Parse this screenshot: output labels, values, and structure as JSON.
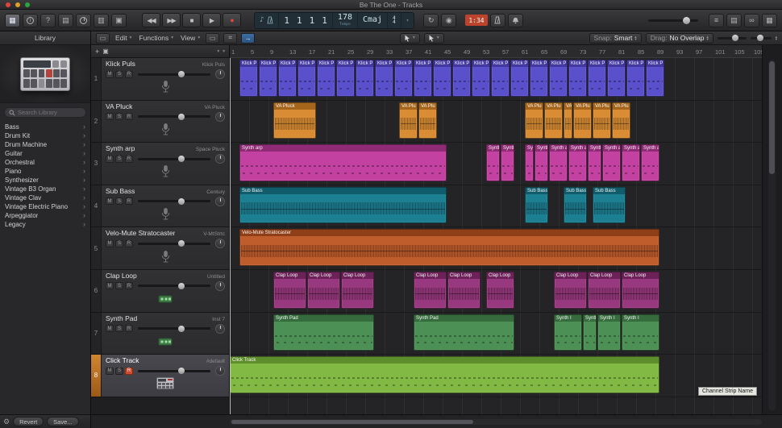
{
  "window": {
    "title": "Be The One - Tracks"
  },
  "toolbar": {
    "transport": {
      "rewind": "◀◀",
      "forward": "▶▶",
      "stop": "■",
      "play": "▶",
      "record": "●"
    },
    "lcd": {
      "position": [
        "1",
        "1",
        "1",
        "1"
      ],
      "tempo": "178",
      "tempo_label": "Tempo",
      "key": "Cmaj",
      "sig_top": "4",
      "sig_bottom": "4"
    },
    "badge": "1:34"
  },
  "arrange_toolbar": {
    "menus": [
      "Edit",
      "Functions",
      "View"
    ],
    "snap_label": "Snap:",
    "snap_value": "Smart",
    "drag_label": "Drag:",
    "drag_value": "No Overlap"
  },
  "library": {
    "title": "Library",
    "search_placeholder": "Search Library",
    "items": [
      {
        "label": "Bass"
      },
      {
        "label": "Drum Kit"
      },
      {
        "label": "Drum Machine"
      },
      {
        "label": "Guitar"
      },
      {
        "label": "Orchestral"
      },
      {
        "label": "Piano"
      },
      {
        "label": "Synthesizer"
      },
      {
        "label": "Vintage B3 Organ"
      },
      {
        "label": "Vintage Clav"
      },
      {
        "label": "Vintage Electric Piano"
      },
      {
        "label": "Arpeggiator"
      },
      {
        "label": "Legacy"
      }
    ],
    "revert_label": "Revert",
    "save_label": "Save..."
  },
  "ruler": {
    "ticks": [
      1,
      5,
      9,
      13,
      17,
      21,
      25,
      29,
      33,
      37,
      41,
      45,
      49,
      53,
      57,
      61,
      65,
      69,
      73,
      77,
      81,
      85,
      89,
      93,
      97,
      101,
      105,
      109
    ]
  },
  "tooltip": "Channel Strip Name",
  "tracks": [
    {
      "num": "1",
      "name": "Klick Puls",
      "patch": "Klick Puls",
      "icon": "mic",
      "pattern": "midi",
      "selected": false,
      "rec": false,
      "colors": {
        "body": "#5b50cb",
        "header": "#43389f"
      },
      "regions": [
        {
          "label": "Klick P",
          "start": 3,
          "len": 4,
          "repeat": 22
        }
      ]
    },
    {
      "num": "2",
      "name": "VA Pluck",
      "patch": "VA Pluck",
      "icon": "mic",
      "pattern": "wave",
      "selected": false,
      "rec": false,
      "colors": {
        "body": "#d98c33",
        "header": "#a5661c"
      },
      "regions": [
        {
          "label": "VA Pluck",
          "start": 10,
          "len": 9
        },
        {
          "label": "VA Plu",
          "start": 36,
          "len": 4
        },
        {
          "label": "VA Plu",
          "start": 40,
          "len": 4
        },
        {
          "label": "VA Plu",
          "start": 62,
          "len": 4
        },
        {
          "label": "VA Plu",
          "start": 66,
          "len": 4
        },
        {
          "label": "VA Plu",
          "start": 70,
          "len": 2
        },
        {
          "label": "VA Plu",
          "start": 72,
          "len": 4
        },
        {
          "label": "VA Plu",
          "start": 76,
          "len": 4
        },
        {
          "label": "VA Plu",
          "start": 80,
          "len": 4
        }
      ]
    },
    {
      "num": "3",
      "name": "Synth arp",
      "patch": "Space Pluck",
      "icon": "mic",
      "pattern": "midi",
      "selected": false,
      "rec": false,
      "colors": {
        "body": "#c341a0",
        "header": "#8f2a75"
      },
      "regions": [
        {
          "label": "Synth arp",
          "start": 3,
          "len": 43
        },
        {
          "label": "Synth a",
          "start": 54,
          "len": 3
        },
        {
          "label": "Synth a",
          "start": 57,
          "len": 3
        },
        {
          "label": "Synth a",
          "start": 62,
          "len": 2
        },
        {
          "label": "Synth a",
          "start": 64,
          "len": 3
        },
        {
          "label": "Synth a",
          "start": 67,
          "len": 4
        },
        {
          "label": "Synth a",
          "start": 71,
          "len": 4
        },
        {
          "label": "Synth a",
          "start": 75,
          "len": 3
        },
        {
          "label": "Synth a",
          "start": 78,
          "len": 4
        },
        {
          "label": "Synth a",
          "start": 82,
          "len": 4
        },
        {
          "label": "Synth a",
          "start": 86,
          "len": 4
        }
      ]
    },
    {
      "num": "4",
      "name": "Sub Bass",
      "patch": "Century",
      "icon": "mic",
      "pattern": "wave",
      "selected": false,
      "rec": false,
      "colors": {
        "body": "#1d7f92",
        "header": "#115c6b"
      },
      "regions": [
        {
          "label": "Sub Bass",
          "start": 3,
          "len": 43
        },
        {
          "label": "Sub Bass",
          "start": 62,
          "len": 5
        },
        {
          "label": "Sub Bass",
          "start": 70,
          "len": 5
        },
        {
          "label": "Sub Bass",
          "start": 76,
          "len": 7
        }
      ]
    },
    {
      "num": "5",
      "name": "Velo-Mute Stratocaster",
      "patch": "V-MtStrtc",
      "icon": "mic",
      "pattern": "wave",
      "selected": false,
      "rec": false,
      "colors": {
        "body": "#c05d2c",
        "header": "#8e3f18"
      },
      "regions": [
        {
          "label": "Velo-Mute Stratocaster",
          "start": 3,
          "len": 87
        }
      ]
    },
    {
      "num": "6",
      "name": "Clap Loop",
      "patch": "Untitled",
      "icon": "module",
      "pattern": "wave",
      "selected": false,
      "rec": false,
      "colors": {
        "body": "#98387e",
        "header": "#6d2159"
      },
      "regions": [
        {
          "label": "Clap Loop",
          "start": 10,
          "len": 7
        },
        {
          "label": "Clap Loop",
          "start": 17,
          "len": 7
        },
        {
          "label": "Clap Loop",
          "start": 24,
          "len": 7
        },
        {
          "label": "Clap Loop",
          "start": 39,
          "len": 7
        },
        {
          "label": "Clap Loop",
          "start": 46,
          "len": 7
        },
        {
          "label": "Clap Loop",
          "start": 54,
          "len": 6
        },
        {
          "label": "Clap Loop",
          "start": 68,
          "len": 7
        },
        {
          "label": "Clap Loop",
          "start": 75,
          "len": 7
        },
        {
          "label": "Clap Loop",
          "start": 82,
          "len": 8
        }
      ]
    },
    {
      "num": "7",
      "name": "Synth Pad",
      "patch": "Inst 7",
      "icon": "module",
      "pattern": "midi",
      "selected": false,
      "rec": false,
      "colors": {
        "body": "#4d9055",
        "header": "#366b3d"
      },
      "regions": [
        {
          "label": "Synth Pad",
          "start": 10,
          "len": 21
        },
        {
          "label": "Synth Pad",
          "start": 39,
          "len": 21
        },
        {
          "label": "Synth I",
          "start": 68,
          "len": 6
        },
        {
          "label": "Synth I",
          "start": 74,
          "len": 3
        },
        {
          "label": "Synth I",
          "start": 77,
          "len": 5
        },
        {
          "label": "Synth I",
          "start": 82,
          "len": 8
        }
      ]
    },
    {
      "num": "8",
      "name": "Click Track",
      "patch": "#default",
      "icon": "drum",
      "pattern": "midi",
      "selected": true,
      "rec": true,
      "colors": {
        "body": "#82b944",
        "header": "#5e8d2b"
      },
      "regions": [
        {
          "label": "Click Track",
          "start": 1,
          "len": 89
        }
      ]
    }
  ]
}
